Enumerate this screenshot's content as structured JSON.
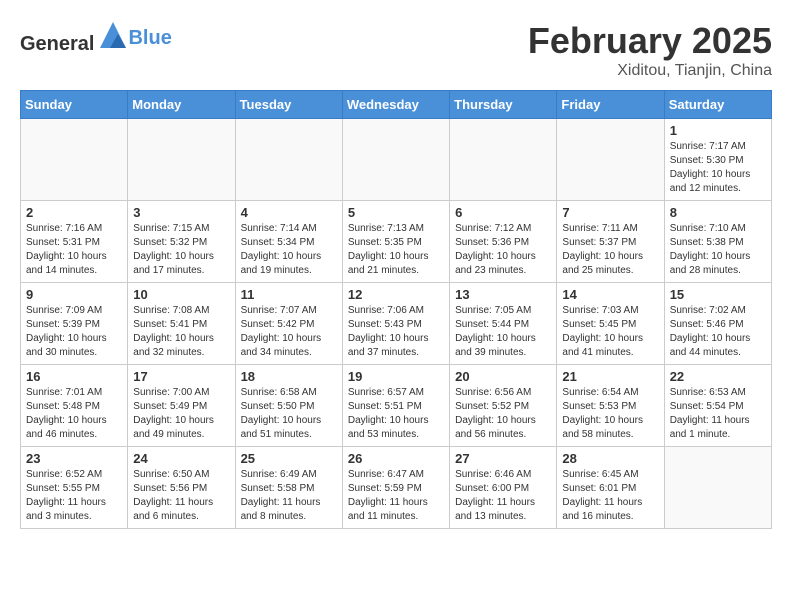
{
  "header": {
    "logo_general": "General",
    "logo_blue": "Blue",
    "month_year": "February 2025",
    "location": "Xiditou, Tianjin, China"
  },
  "weekdays": [
    "Sunday",
    "Monday",
    "Tuesday",
    "Wednesday",
    "Thursday",
    "Friday",
    "Saturday"
  ],
  "weeks": [
    [
      {
        "day": "",
        "info": ""
      },
      {
        "day": "",
        "info": ""
      },
      {
        "day": "",
        "info": ""
      },
      {
        "day": "",
        "info": ""
      },
      {
        "day": "",
        "info": ""
      },
      {
        "day": "",
        "info": ""
      },
      {
        "day": "1",
        "info": "Sunrise: 7:17 AM\nSunset: 5:30 PM\nDaylight: 10 hours\nand 12 minutes."
      }
    ],
    [
      {
        "day": "2",
        "info": "Sunrise: 7:16 AM\nSunset: 5:31 PM\nDaylight: 10 hours\nand 14 minutes."
      },
      {
        "day": "3",
        "info": "Sunrise: 7:15 AM\nSunset: 5:32 PM\nDaylight: 10 hours\nand 17 minutes."
      },
      {
        "day": "4",
        "info": "Sunrise: 7:14 AM\nSunset: 5:34 PM\nDaylight: 10 hours\nand 19 minutes."
      },
      {
        "day": "5",
        "info": "Sunrise: 7:13 AM\nSunset: 5:35 PM\nDaylight: 10 hours\nand 21 minutes."
      },
      {
        "day": "6",
        "info": "Sunrise: 7:12 AM\nSunset: 5:36 PM\nDaylight: 10 hours\nand 23 minutes."
      },
      {
        "day": "7",
        "info": "Sunrise: 7:11 AM\nSunset: 5:37 PM\nDaylight: 10 hours\nand 25 minutes."
      },
      {
        "day": "8",
        "info": "Sunrise: 7:10 AM\nSunset: 5:38 PM\nDaylight: 10 hours\nand 28 minutes."
      }
    ],
    [
      {
        "day": "9",
        "info": "Sunrise: 7:09 AM\nSunset: 5:39 PM\nDaylight: 10 hours\nand 30 minutes."
      },
      {
        "day": "10",
        "info": "Sunrise: 7:08 AM\nSunset: 5:41 PM\nDaylight: 10 hours\nand 32 minutes."
      },
      {
        "day": "11",
        "info": "Sunrise: 7:07 AM\nSunset: 5:42 PM\nDaylight: 10 hours\nand 34 minutes."
      },
      {
        "day": "12",
        "info": "Sunrise: 7:06 AM\nSunset: 5:43 PM\nDaylight: 10 hours\nand 37 minutes."
      },
      {
        "day": "13",
        "info": "Sunrise: 7:05 AM\nSunset: 5:44 PM\nDaylight: 10 hours\nand 39 minutes."
      },
      {
        "day": "14",
        "info": "Sunrise: 7:03 AM\nSunset: 5:45 PM\nDaylight: 10 hours\nand 41 minutes."
      },
      {
        "day": "15",
        "info": "Sunrise: 7:02 AM\nSunset: 5:46 PM\nDaylight: 10 hours\nand 44 minutes."
      }
    ],
    [
      {
        "day": "16",
        "info": "Sunrise: 7:01 AM\nSunset: 5:48 PM\nDaylight: 10 hours\nand 46 minutes."
      },
      {
        "day": "17",
        "info": "Sunrise: 7:00 AM\nSunset: 5:49 PM\nDaylight: 10 hours\nand 49 minutes."
      },
      {
        "day": "18",
        "info": "Sunrise: 6:58 AM\nSunset: 5:50 PM\nDaylight: 10 hours\nand 51 minutes."
      },
      {
        "day": "19",
        "info": "Sunrise: 6:57 AM\nSunset: 5:51 PM\nDaylight: 10 hours\nand 53 minutes."
      },
      {
        "day": "20",
        "info": "Sunrise: 6:56 AM\nSunset: 5:52 PM\nDaylight: 10 hours\nand 56 minutes."
      },
      {
        "day": "21",
        "info": "Sunrise: 6:54 AM\nSunset: 5:53 PM\nDaylight: 10 hours\nand 58 minutes."
      },
      {
        "day": "22",
        "info": "Sunrise: 6:53 AM\nSunset: 5:54 PM\nDaylight: 11 hours\nand 1 minute."
      }
    ],
    [
      {
        "day": "23",
        "info": "Sunrise: 6:52 AM\nSunset: 5:55 PM\nDaylight: 11 hours\nand 3 minutes."
      },
      {
        "day": "24",
        "info": "Sunrise: 6:50 AM\nSunset: 5:56 PM\nDaylight: 11 hours\nand 6 minutes."
      },
      {
        "day": "25",
        "info": "Sunrise: 6:49 AM\nSunset: 5:58 PM\nDaylight: 11 hours\nand 8 minutes."
      },
      {
        "day": "26",
        "info": "Sunrise: 6:47 AM\nSunset: 5:59 PM\nDaylight: 11 hours\nand 11 minutes."
      },
      {
        "day": "27",
        "info": "Sunrise: 6:46 AM\nSunset: 6:00 PM\nDaylight: 11 hours\nand 13 minutes."
      },
      {
        "day": "28",
        "info": "Sunrise: 6:45 AM\nSunset: 6:01 PM\nDaylight: 11 hours\nand 16 minutes."
      },
      {
        "day": "",
        "info": ""
      }
    ]
  ]
}
